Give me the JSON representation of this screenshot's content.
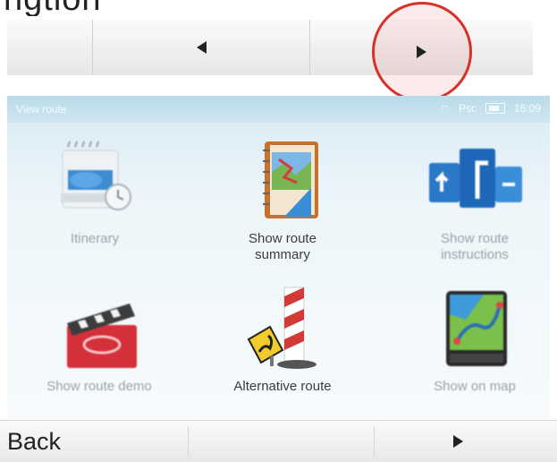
{
  "heading_fragment": "ngtion",
  "top_bar": {
    "prev_icon": "triangle-left-icon",
    "next_icon": "triangle-right-icon",
    "highlight_color": "#d9302a"
  },
  "status_bar": {
    "title": "View route",
    "signal": "Psc",
    "time": "16:09"
  },
  "tiles": [
    {
      "label": "Itinerary",
      "icon": "itinerary-icon"
    },
    {
      "label": "Show route summary",
      "icon": "route-summary-icon"
    },
    {
      "label": "Show route instructions",
      "icon": "route-instructions-icon"
    },
    {
      "label": "Show route demo",
      "icon": "route-demo-icon"
    },
    {
      "label": "Alternative route",
      "icon": "alternative-route-icon"
    },
    {
      "label": "Show on map",
      "icon": "show-on-map-icon"
    }
  ],
  "bottom_bar": {
    "back_label": "Back",
    "next_icon": "triangle-right-icon"
  }
}
